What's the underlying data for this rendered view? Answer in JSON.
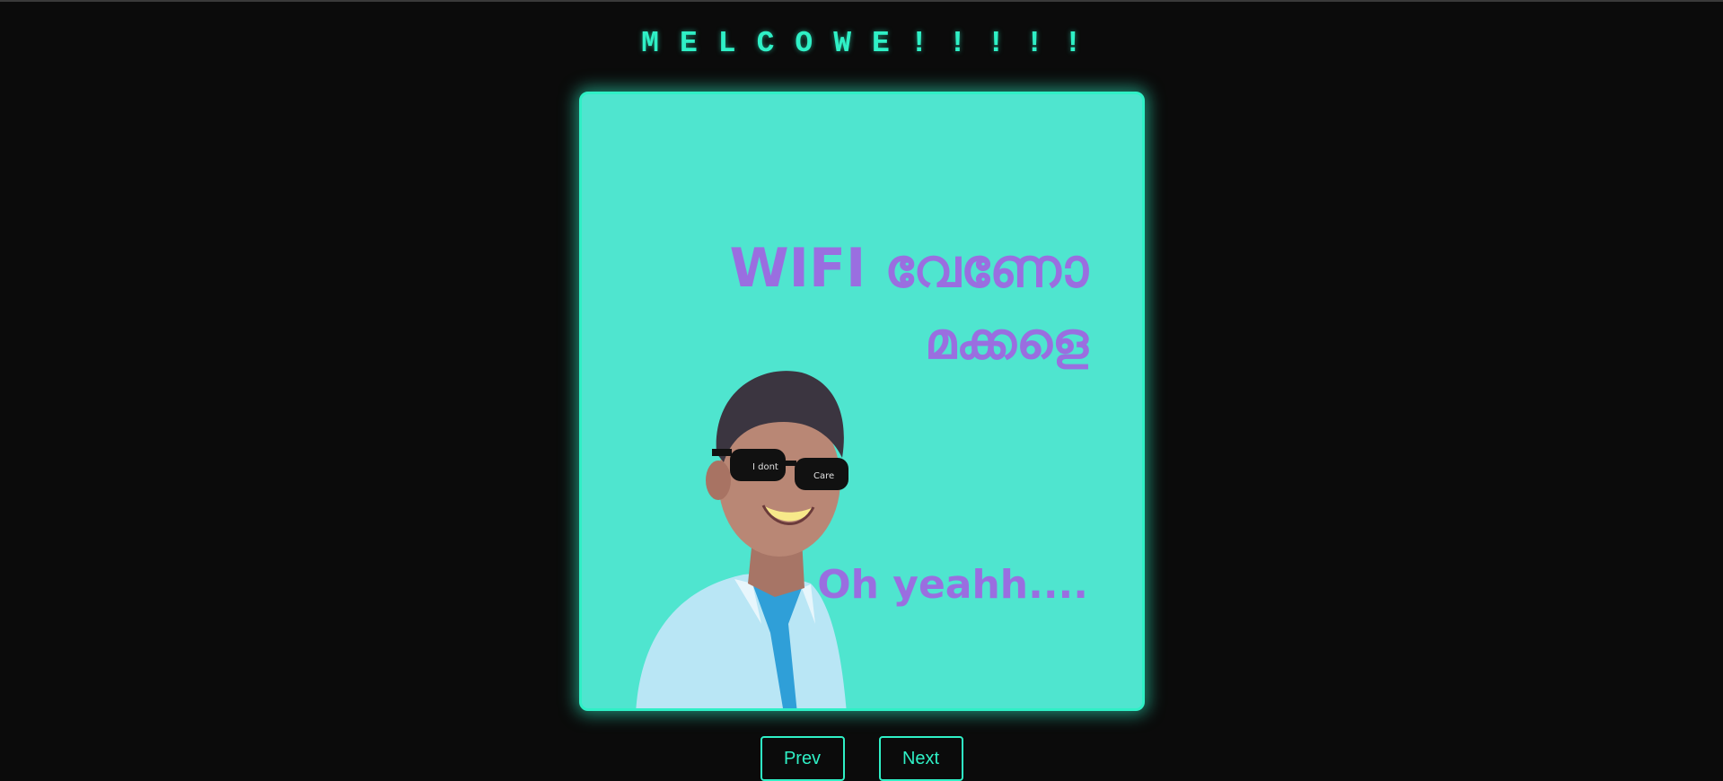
{
  "header": {
    "title": "MELCOWE!!!!!"
  },
  "meme": {
    "line1": "WIFI വേണോ",
    "line2": "മക്കളെ",
    "line3": "Oh yeahh....",
    "glasses_left_text": "I dont",
    "glasses_right_text": "Care"
  },
  "controls": {
    "prev_label": "Prev",
    "next_label": "Next"
  },
  "colors": {
    "background": "#0b0b0b",
    "accent": "#2ff0c6",
    "image_background": "#4fe5cf",
    "meme_text": "#9a6ee0"
  }
}
